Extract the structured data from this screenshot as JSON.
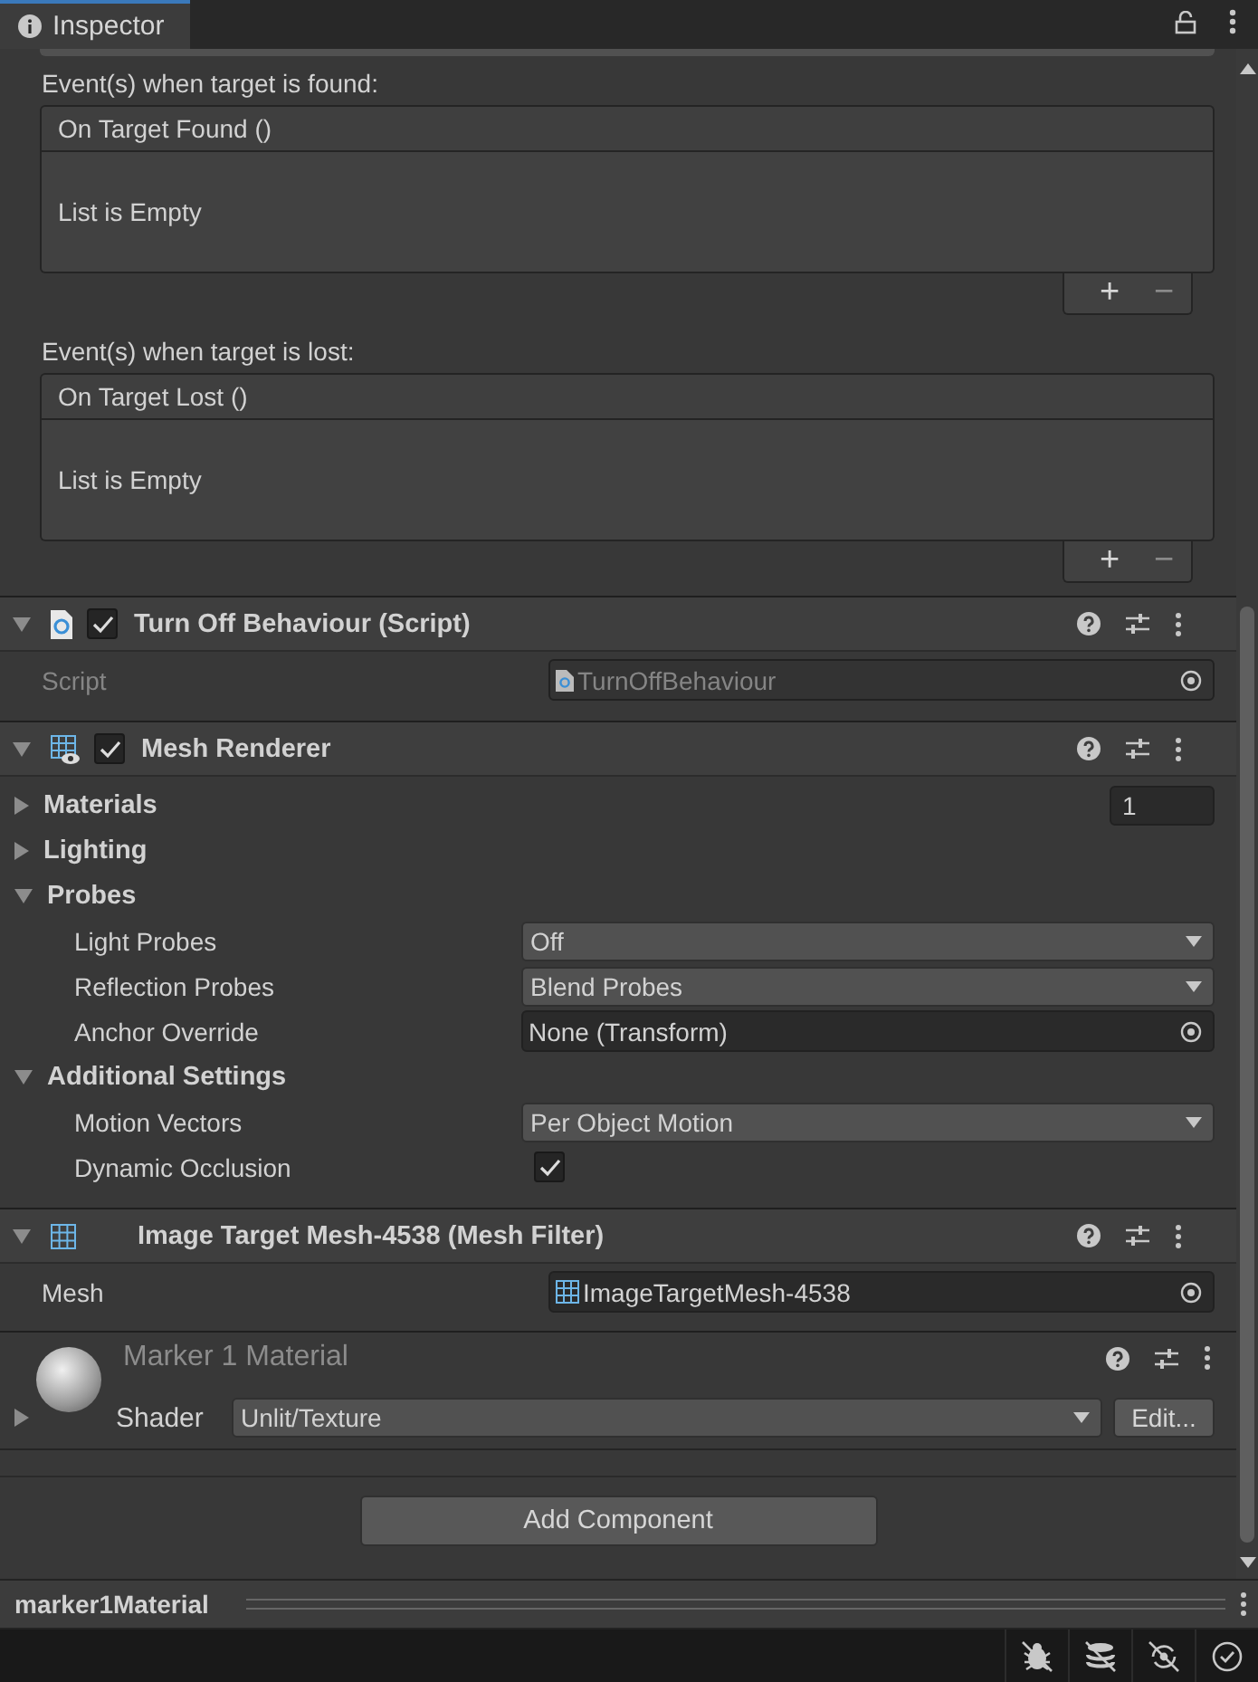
{
  "window": {
    "title": "Inspector"
  },
  "events": [
    {
      "label": "Event(s) when target is found:",
      "header": "On Target Found ()",
      "empty_text": "List is Empty",
      "add": "+",
      "remove": "−"
    },
    {
      "label": "Event(s) when target is lost:",
      "header": "On Target Lost ()",
      "empty_text": "List is Empty",
      "add": "+",
      "remove": "−"
    }
  ],
  "components": [
    {
      "kind": "script",
      "title": "Turn Off Behaviour (Script)",
      "expanded": true,
      "enabled": true,
      "rows": [
        {
          "kind": "object",
          "label": "Script",
          "value": "TurnOffBehaviour",
          "disabled": true
        }
      ]
    },
    {
      "kind": "renderer",
      "title": "Mesh Renderer",
      "expanded": true,
      "enabled": true,
      "rows": [
        {
          "kind": "foldout",
          "label": "Materials",
          "expanded": false,
          "count": "1"
        },
        {
          "kind": "foldout",
          "label": "Lighting",
          "expanded": false
        },
        {
          "kind": "foldout",
          "label": "Probes",
          "expanded": true,
          "children": [
            {
              "kind": "dropdown",
              "label": "Light Probes",
              "value": "Off"
            },
            {
              "kind": "dropdown",
              "label": "Reflection Probes",
              "value": "Blend Probes"
            },
            {
              "kind": "object",
              "label": "Anchor Override",
              "value": "None (Transform)",
              "disabled": false
            }
          ]
        },
        {
          "kind": "foldout",
          "label": "Additional Settings",
          "expanded": true,
          "children": [
            {
              "kind": "dropdown",
              "label": "Motion Vectors",
              "value": "Per Object Motion"
            },
            {
              "kind": "checkbox",
              "label": "Dynamic Occlusion",
              "checked": true
            }
          ]
        }
      ]
    },
    {
      "kind": "mesh",
      "title": "Image Target Mesh-4538 (Mesh Filter)",
      "expanded": true,
      "rows": [
        {
          "kind": "object",
          "label": "Mesh",
          "value": "ImageTargetMesh-4538",
          "disabled": false
        }
      ]
    }
  ],
  "material": {
    "name": "Marker 1 Material",
    "expanded": false,
    "shader_label": "Shader",
    "shader": "Unlit/Texture",
    "edit": "Edit..."
  },
  "add_component": "Add Component",
  "preview": {
    "title": "marker1Material"
  }
}
